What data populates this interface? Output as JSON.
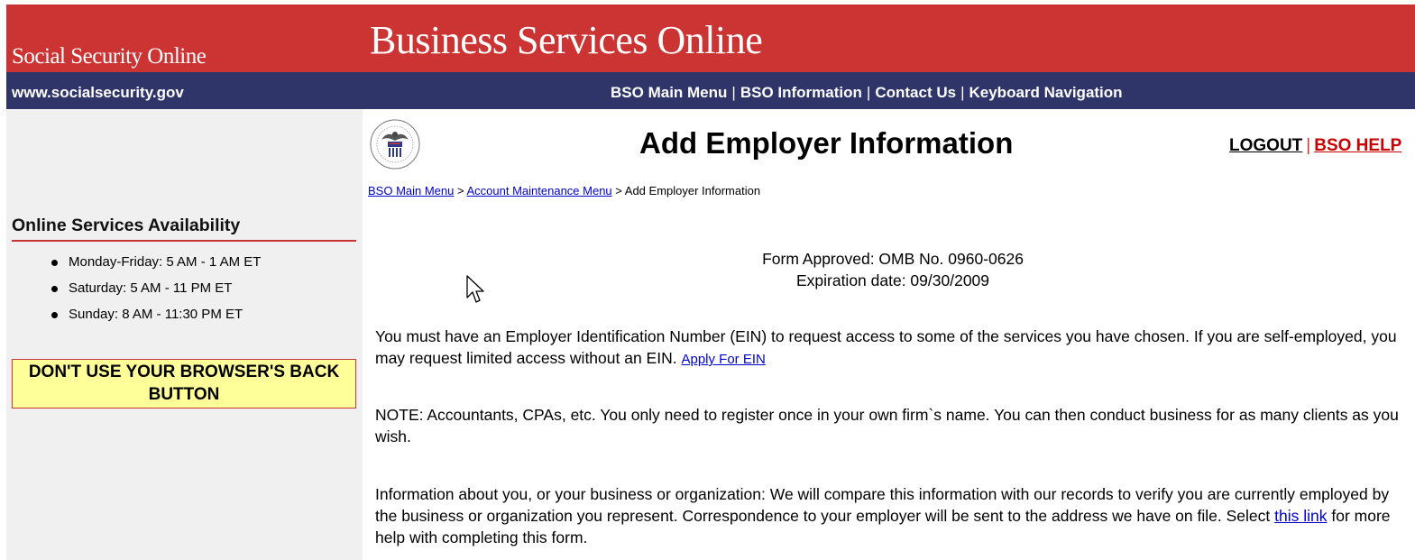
{
  "header": {
    "site_name": "Social Security Online",
    "app_title": "Business Services Online",
    "site_url_pre": "www.",
    "site_url_key": "s",
    "site_url_post": "ocialsecurity.gov",
    "nav": {
      "main_menu_pre": "BSO ",
      "main_menu_key": "M",
      "main_menu_post": "ain Menu",
      "information_pre": "BSO ",
      "information_key": "I",
      "information_post": "nformation",
      "contact_pre": "Contact ",
      "contact_key": "U",
      "contact_post": "s",
      "keyboard_pre": "Keyboard ",
      "keyboard_key": "N",
      "keyboard_post": "avigation",
      "separator": "|"
    }
  },
  "sidebar": {
    "availability_title": "Online Services Availability",
    "hours": [
      "Monday-Friday: 5 AM - 1 AM ET",
      "Saturday: 5 AM - 11 PM ET",
      "Sunday: 8 AM - 11:30 PM ET"
    ],
    "warning_line1": "DON'T USE YOUR BROWSER'S BACK",
    "warning_line2": "BUTTON"
  },
  "page": {
    "title": "Add Employer Information",
    "logout": "LOGOUT",
    "link_separator": "|",
    "help": "BSO HELP",
    "breadcrumb": {
      "main_menu": "BSO Main Menu",
      "sep": ">",
      "account_menu": "Account Maintenance Menu",
      "current": "Add Employer Information"
    },
    "form_approved": "Form Approved: OMB No. 0960-0626",
    "expiration": "Expiration date: 09/30/2009",
    "ein_text": "You must have an Employer Identification Number (EIN) to request access to some of the services you have chosen. If you are self-employed, you may request limited access without an EIN.",
    "apply_ein_link": "Apply For EIN",
    "note_text": "NOTE: Accountants, CPAs, etc. You only need to register once in your own firm`s name. You can then conduct business for as many clients as you wish.",
    "info_text_pre": "Information about you, or your business or organization: We will compare this information with our records to verify you are currently employed by the business or organization you represent. Correspondence to your employer will be sent to the address we have on file. Select",
    "this_link": "this link",
    "info_text_post": "for more help with completing this form."
  },
  "colors": {
    "header_red": "#cc3333",
    "nav_blue": "#2f3568",
    "sidebar_gray": "#f0f0f0",
    "warning_yellow": "#ffff99",
    "link_blue": "#0000cc"
  },
  "icons": [
    "ssa-seal-icon",
    "mouse-pointer-icon"
  ]
}
